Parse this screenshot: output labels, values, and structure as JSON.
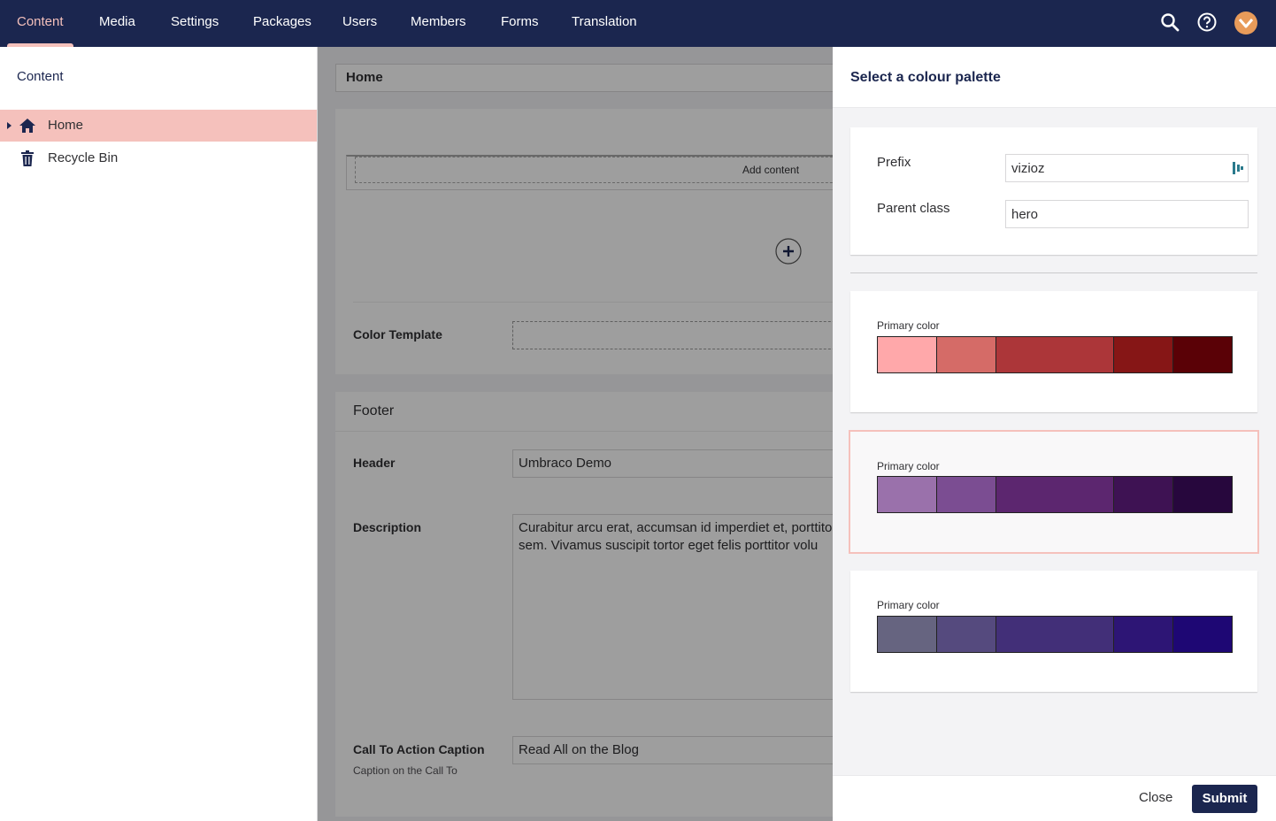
{
  "nav": {
    "items": [
      "Content",
      "Media",
      "Settings",
      "Packages",
      "Users",
      "Members",
      "Forms",
      "Translation"
    ],
    "active": "Content"
  },
  "sidebar": {
    "title": "Content",
    "tree": [
      {
        "label": "Home",
        "icon": "home-icon",
        "selected": true
      },
      {
        "label": "Recycle Bin",
        "icon": "trash-icon",
        "selected": false
      }
    ]
  },
  "main": {
    "node_name": "Home",
    "add_content": "Add content",
    "color_template_label": "Color Template",
    "footer": {
      "title": "Footer",
      "header_label": "Header",
      "header_value": "Umbraco Demo",
      "description_label": "Description",
      "description_value": "Curabitur arcu erat, accumsan id imperdiet et, porttitor at sem. Vivamus suscipit tortor eget felis porttitor volu",
      "cta_label": "Call To Action Caption",
      "cta_help": "Caption on the Call To",
      "cta_value": "Read All on the Blog"
    }
  },
  "panel": {
    "title": "Select a colour palette",
    "prefix_label": "Prefix",
    "prefix_value": "vizioz",
    "parent_class_label": "Parent class",
    "parent_class_value": "hero",
    "palettes": [
      {
        "label": "Primary color",
        "colors": [
          "#ffa8aa",
          "#d56b67",
          "#ac3639",
          "#861616",
          "#5a0106"
        ],
        "selected": false
      },
      {
        "label": "Primary color",
        "colors": [
          "#9a71ab",
          "#7b4d92",
          "#5c266f",
          "#3e1253",
          "#27073d"
        ],
        "selected": true
      },
      {
        "label": "Primary color",
        "colors": [
          "#666480",
          "#554a7e",
          "#422f78",
          "#2d1575",
          "#1e0774"
        ],
        "selected": false
      }
    ],
    "close_label": "Close",
    "submit_label": "Submit"
  }
}
